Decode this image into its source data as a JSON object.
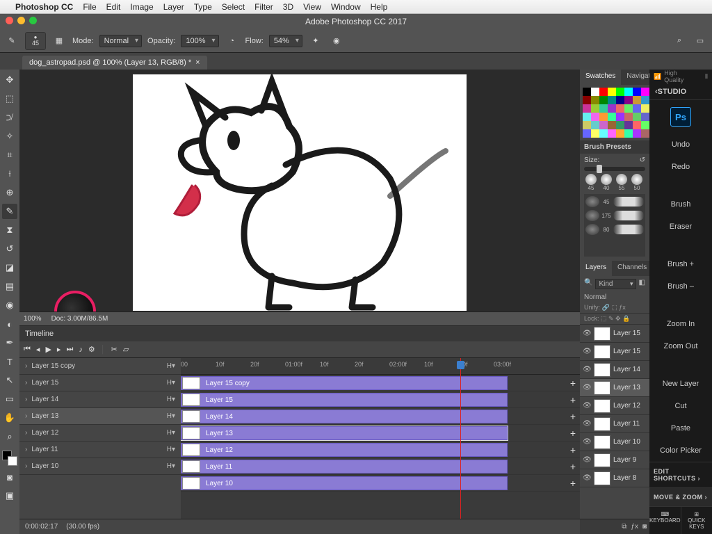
{
  "mac_menu": {
    "app": "Photoshop CC",
    "items": [
      "File",
      "Edit",
      "Image",
      "Layer",
      "Type",
      "Select",
      "Filter",
      "3D",
      "View",
      "Window",
      "Help"
    ]
  },
  "window_title": "Adobe Photoshop CC 2017",
  "options_bar": {
    "brush_size": "45",
    "mode_label": "Mode:",
    "mode_value": "Normal",
    "opacity_label": "Opacity:",
    "opacity_value": "100%",
    "flow_label": "Flow:",
    "flow_value": "54%"
  },
  "doc_tab": "dog_astropad.psd @ 100% (Layer 13, RGB/8) *",
  "status": {
    "zoom": "100%",
    "doc": "Doc: 3.00M/86.5M"
  },
  "timeline": {
    "title": "Timeline",
    "ruler": [
      "00",
      "10f",
      "20f",
      "01:00f",
      "10f",
      "20f",
      "02:00f",
      "10f",
      "20f",
      "03:00f"
    ],
    "playhead_label": "20f",
    "tracks": [
      {
        "name": "Layer 15 copy"
      },
      {
        "name": "Layer 15"
      },
      {
        "name": "Layer 14"
      },
      {
        "name": "Layer 13",
        "selected": true
      },
      {
        "name": "Layer 12"
      },
      {
        "name": "Layer 11"
      },
      {
        "name": "Layer 10"
      }
    ],
    "footer_time": "0:00:02:17",
    "footer_fps": "(30.00 fps)"
  },
  "swatches": {
    "tabs": [
      "Swatches",
      "Navigator"
    ],
    "colors": [
      "#000",
      "#fff",
      "#f00",
      "#ff0",
      "#0f0",
      "#0ff",
      "#00f",
      "#f0f",
      "#800",
      "#880",
      "#080",
      "#088",
      "#008",
      "#808",
      "#c93",
      "#39c",
      "#c39",
      "#9c3",
      "#3c9",
      "#93c",
      "#e66",
      "#6e6",
      "#66e",
      "#ee6",
      "#6ee",
      "#e6e",
      "#f93",
      "#3f9",
      "#93f",
      "#c66",
      "#6c6",
      "#66c",
      "#cc6",
      "#6cc",
      "#c6c",
      "#963",
      "#396",
      "#639",
      "#f66",
      "#6f6",
      "#66f",
      "#ff6",
      "#6ff",
      "#f6f",
      "#fa3",
      "#3fa",
      "#a3f",
      "#a66"
    ]
  },
  "brush_presets": {
    "title": "Brush Presets",
    "size_label": "Size:",
    "brushes": [
      "45",
      "40",
      "55",
      "50"
    ],
    "stroke_sizes": [
      "45",
      "175",
      "80"
    ]
  },
  "layers": {
    "tabs": [
      "Layers",
      "Channels"
    ],
    "kind": "Kind",
    "blend": "Normal",
    "unify": "Unify:",
    "lock": "Lock:",
    "list": [
      "Layer 15",
      "Layer 15",
      "Layer 14",
      "Layer 13",
      "Layer 12",
      "Layer 11",
      "Layer 10",
      "Layer 9",
      "Layer 8"
    ],
    "selected": "Layer 13"
  },
  "astropad": {
    "quality": "High Quality",
    "studio": "STUDIO",
    "ps": "Ps",
    "buttons": [
      "Undo",
      "Redo",
      "",
      "Brush",
      "Eraser",
      "",
      "Brush  +",
      "Brush  –",
      "",
      "Zoom In",
      "Zoom Out",
      "",
      "New Layer",
      "Cut",
      "Paste",
      "Color Picker"
    ],
    "edit_shortcuts": "EDIT SHORTCUTS ›",
    "move_zoom": "MOVE & ZOOM  ›",
    "keyboard": "KEYBOARD",
    "quickkeys": "QUICK KEYS"
  }
}
